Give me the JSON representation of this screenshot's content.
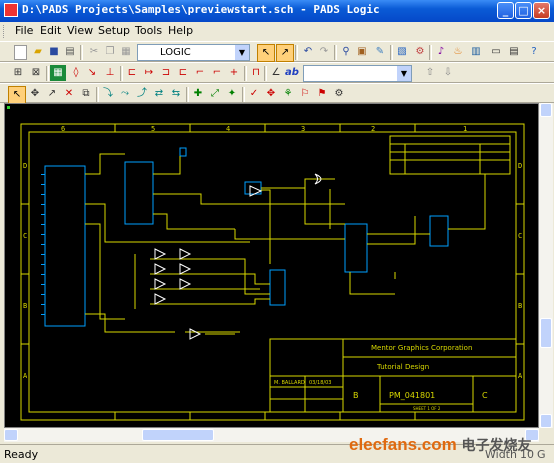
{
  "window": {
    "title": "D:\\PADS Projects\\Samples\\previewstart.sch - PADS Logic",
    "minimize_glyph": "_",
    "maximize_glyph": "□",
    "close_glyph": "×"
  },
  "menu": [
    {
      "label": "File"
    },
    {
      "label": "Edit"
    },
    {
      "label": "View"
    },
    {
      "label": "Setup"
    },
    {
      "label": "Tools"
    },
    {
      "label": "Help"
    }
  ],
  "toolbar": {
    "part_type_value": "LOGIC",
    "search_value": ""
  },
  "sheet": {
    "col_numbers": [
      "6",
      "5",
      "4",
      "3",
      "2",
      "1"
    ],
    "row_letters": [
      "D",
      "C",
      "B",
      "A"
    ],
    "company": "Mentor Graphics Corporation",
    "design_title": "Tutorial Design",
    "doc_number": "PM_041801",
    "size": "B",
    "rev": "C",
    "drawn_by": "M. BALLARD",
    "date": "03/18/03",
    "sheet_info": "SHEET 1 OF 2"
  },
  "statusbar": {
    "ready": "Ready",
    "width_label": "Width",
    "width_value": "10",
    "grid_value": "G"
  },
  "watermark": {
    "text": "elecfans.com",
    "cn_text": "电子发烧友"
  }
}
